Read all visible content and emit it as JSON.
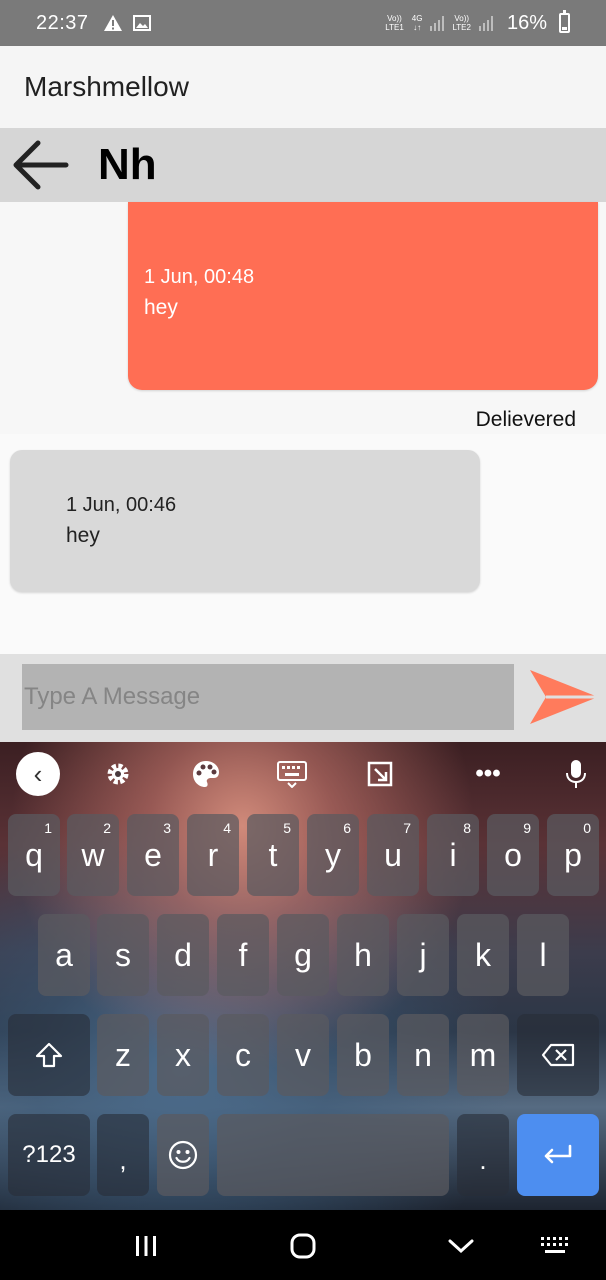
{
  "status_bar": {
    "time": "22:37",
    "sim1_label_top": "Vo))",
    "sim1_label_bottom": "LTE1",
    "network_type_top": "4G",
    "network_type_bottom": "↓↑",
    "sim2_label_top": "Vo))",
    "sim2_label_bottom": "LTE2",
    "battery": "16%"
  },
  "app_bar": {
    "title": "Marshmellow"
  },
  "chat_header": {
    "contact_name": "Nh"
  },
  "messages": [
    {
      "direction": "sent",
      "timestamp": "1 Jun, 00:48",
      "text": "hey",
      "status": "Delievered"
    },
    {
      "direction": "received",
      "timestamp": "1 Jun, 00:46",
      "text": "hey"
    }
  ],
  "composer": {
    "placeholder": "Type A Message",
    "value": ""
  },
  "keyboard": {
    "row1": [
      {
        "letter": "q",
        "num": "1"
      },
      {
        "letter": "w",
        "num": "2"
      },
      {
        "letter": "e",
        "num": "3"
      },
      {
        "letter": "r",
        "num": "4"
      },
      {
        "letter": "t",
        "num": "5"
      },
      {
        "letter": "y",
        "num": "6"
      },
      {
        "letter": "u",
        "num": "7"
      },
      {
        "letter": "i",
        "num": "8"
      },
      {
        "letter": "o",
        "num": "9"
      },
      {
        "letter": "p",
        "num": "0"
      }
    ],
    "row2": [
      "a",
      "s",
      "d",
      "f",
      "g",
      "h",
      "j",
      "k",
      "l"
    ],
    "row3": [
      "z",
      "x",
      "c",
      "v",
      "b",
      "n",
      "m"
    ],
    "symbols_label": "?123",
    "comma_label": ",",
    "period_label": "."
  },
  "colors": {
    "sent_bubble": "#ff6e54",
    "received_bubble": "#d9d9d9",
    "send_icon": "#ff7b5c",
    "enter_key": "#4d8ef0"
  },
  "icons": {
    "toolbar": [
      "chevron-left-icon",
      "gear-icon",
      "palette-icon",
      "keyboard-icon",
      "resize-icon",
      "more-icon",
      "mic-icon"
    ],
    "send": "send-icon",
    "back": "back-arrow-icon"
  }
}
